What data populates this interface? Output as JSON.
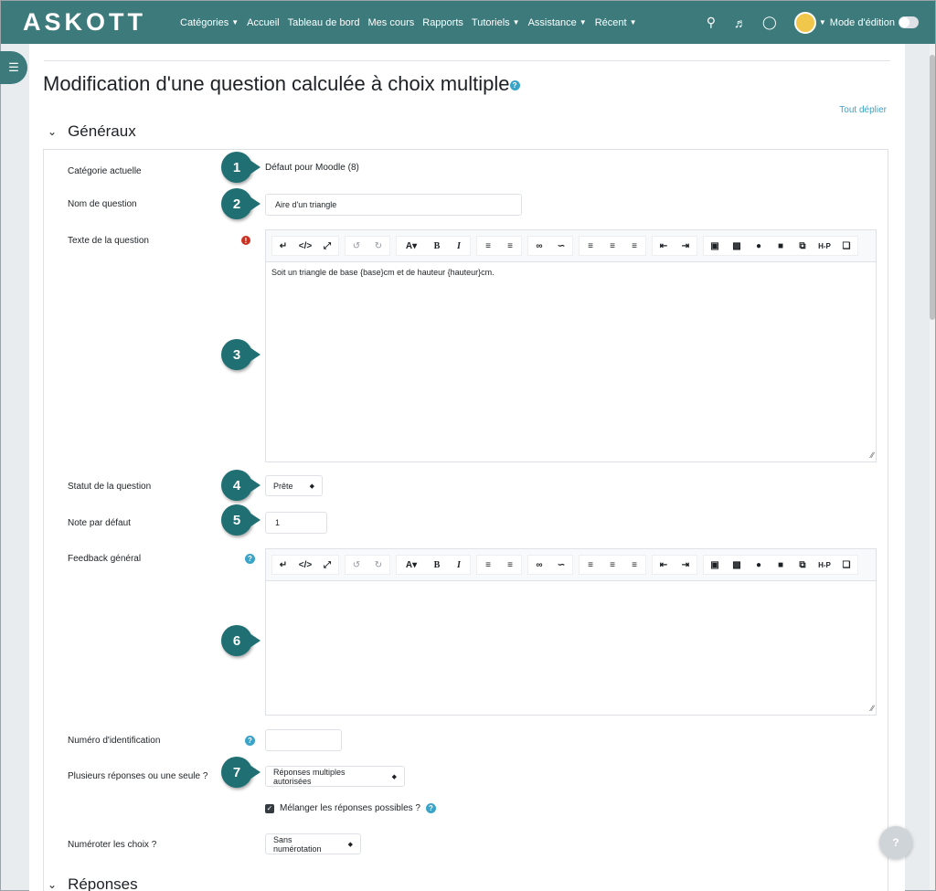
{
  "navbar": {
    "logo": "ASKOTT",
    "items": [
      {
        "label": "Catégories",
        "dropdown": true
      },
      {
        "label": "Accueil",
        "dropdown": false
      },
      {
        "label": "Tableau de bord",
        "dropdown": false
      },
      {
        "label": "Mes cours",
        "dropdown": false
      },
      {
        "label": "Rapports",
        "dropdown": false
      },
      {
        "label": "Tutoriels",
        "dropdown": true
      },
      {
        "label": "Assistance",
        "dropdown": true
      },
      {
        "label": "Récent",
        "dropdown": true
      }
    ],
    "mode_label": "Mode d'édition",
    "color": "#3d7a7b"
  },
  "page": {
    "title": "Modification d'une question calculée à choix multiple",
    "expand_all": "Tout déplier",
    "section_title": "Généraux",
    "next_section_title": "Réponses"
  },
  "form": {
    "current_category_label": "Catégorie actuelle",
    "current_category_value": "Défaut pour Moodle (8)",
    "question_name_label": "Nom de question",
    "question_name_value": "Aire d'un triangle",
    "question_text_label": "Texte de la question",
    "question_text_value": "Soit un triangle de base {base}cm et de hauteur  {hauteur}cm.",
    "status_label": "Statut de la question",
    "status_value": "Prête",
    "default_mark_label": "Note par défaut",
    "default_mark_value": "1",
    "general_feedback_label": "Feedback général",
    "general_feedback_value": "",
    "idnumber_label": "Numéro d'identification",
    "idnumber_value": "",
    "single_label": "Plusieurs réponses ou une seule ?",
    "single_value": "Réponses multiples autorisées",
    "shuffle_label": "Mélanger les réponses possibles ?",
    "shuffle_checked": true,
    "numbering_label": "Numéroter les choix ?",
    "numbering_value": "Sans numérotation"
  },
  "toolbar_icons": [
    [
      "arrow-down-icon",
      "code-icon",
      "fullscreen-icon"
    ],
    [
      "undo-icon",
      "redo-icon"
    ],
    [
      "font-color-icon",
      "bold-icon",
      "italic-icon"
    ],
    [
      "bullet-list-icon",
      "numbered-list-icon"
    ],
    [
      "link-icon",
      "unlink-icon"
    ],
    [
      "align-left-icon",
      "align-center-icon",
      "align-right-icon"
    ],
    [
      "outdent-icon",
      "indent-icon"
    ],
    [
      "image-icon",
      "media-icon",
      "record-audio-icon",
      "record-video-icon",
      "manage-files-icon",
      "h5p-icon",
      "package-icon"
    ]
  ],
  "callouts": [
    "1",
    "2",
    "3",
    "4",
    "5",
    "6",
    "7"
  ],
  "float_help": "?"
}
